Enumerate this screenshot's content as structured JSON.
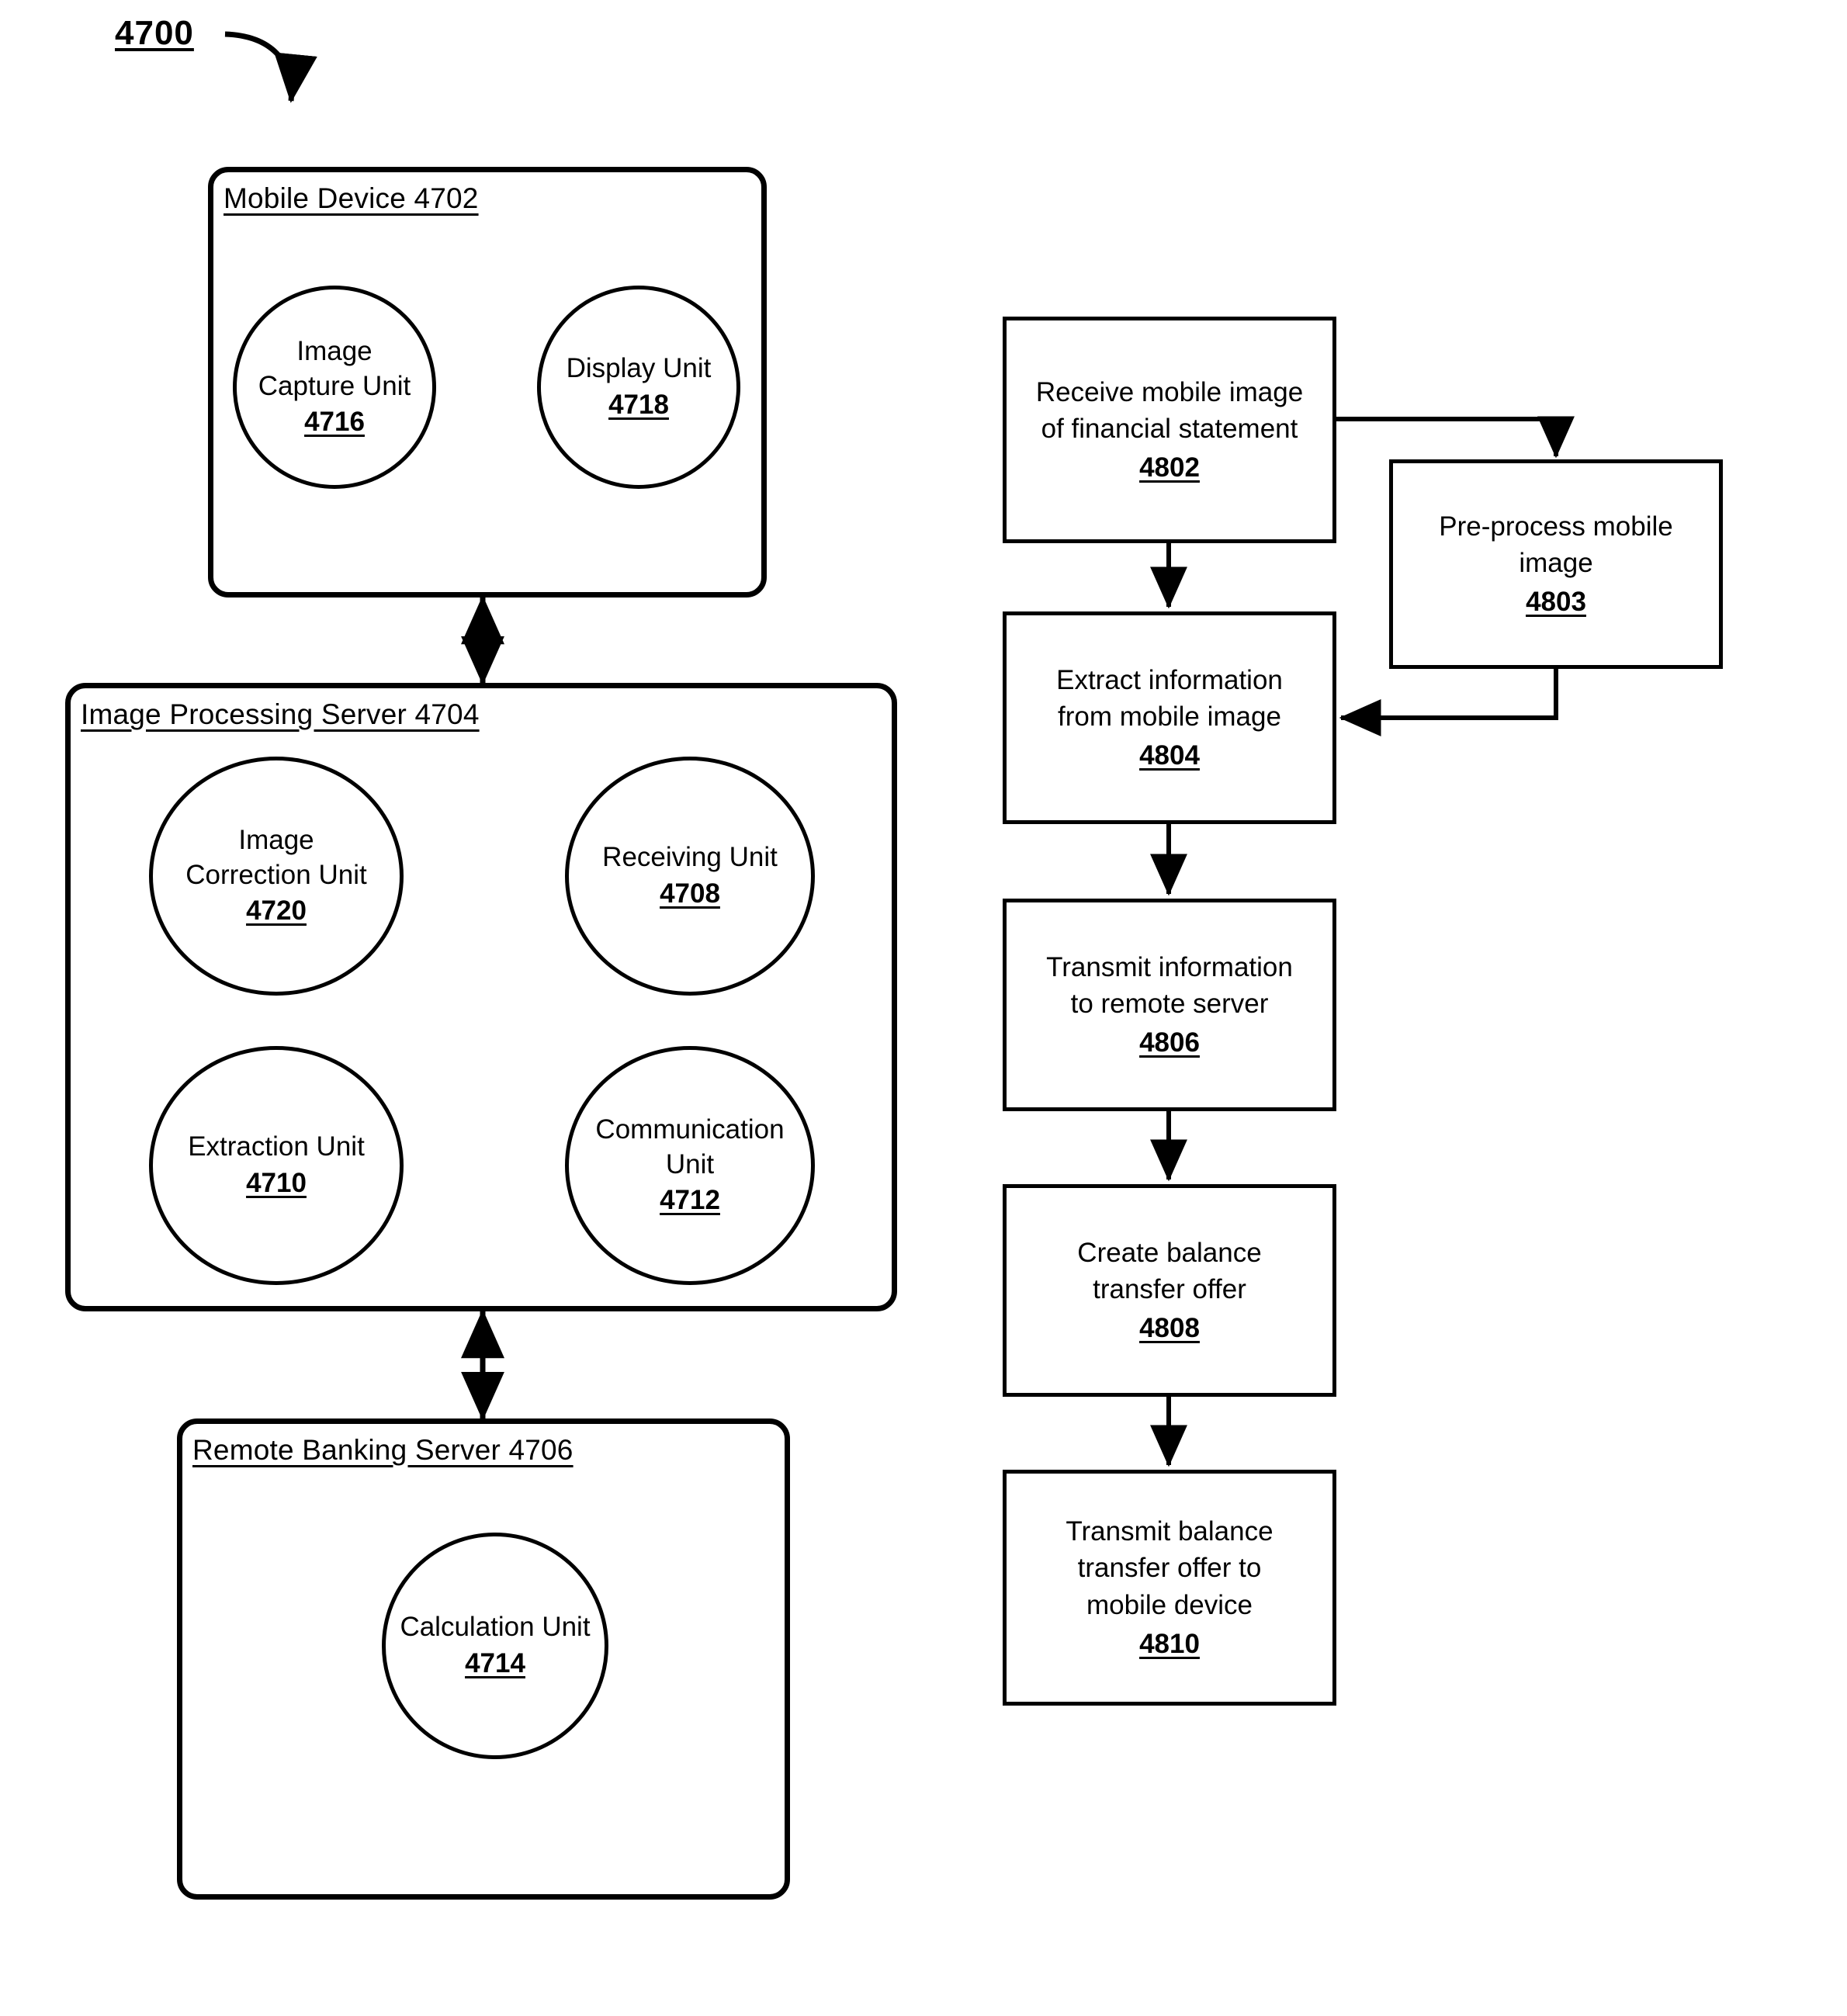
{
  "figure": {
    "number": "4700"
  },
  "system_diagram": {
    "mobile_device": {
      "title": "Mobile Device 4702",
      "units": [
        {
          "name": "Image Capture Unit",
          "line1": "Image",
          "line2": "Capture Unit",
          "ref": "4716"
        },
        {
          "name": "Display Unit",
          "line1": "Display Unit",
          "line2": "",
          "ref": "4718"
        }
      ]
    },
    "image_processing_server": {
      "title": "Image Processing Server 4704",
      "units": [
        {
          "name": "Image Correction Unit",
          "line1": "Image",
          "line2": "Correction Unit",
          "ref": "4720"
        },
        {
          "name": "Receiving Unit",
          "line1": "Receiving Unit",
          "line2": "",
          "ref": "4708"
        },
        {
          "name": "Extraction Unit",
          "line1": "Extraction Unit",
          "line2": "",
          "ref": "4710"
        },
        {
          "name": "Communication Unit",
          "line1": "Communication",
          "line2": "Unit",
          "ref": "4712"
        }
      ]
    },
    "remote_banking_server": {
      "title": "Remote Banking Server 4706",
      "units": [
        {
          "name": "Calculation Unit",
          "line1": "Calculation Unit",
          "line2": "",
          "ref": "4714"
        }
      ]
    }
  },
  "flowchart": {
    "steps": [
      {
        "id": "step-4802",
        "line1": "Receive mobile image",
        "line2": "of financial statement",
        "line3": "",
        "ref": "4802"
      },
      {
        "id": "step-4803",
        "line1": "Pre-process mobile",
        "line2": "image",
        "line3": "",
        "ref": "4803"
      },
      {
        "id": "step-4804",
        "line1": "Extract information",
        "line2": "from mobile image",
        "line3": "",
        "ref": "4804"
      },
      {
        "id": "step-4806",
        "line1": "Transmit information",
        "line2": "to remote server",
        "line3": "",
        "ref": "4806"
      },
      {
        "id": "step-4808",
        "line1": "Create balance",
        "line2": "transfer offer",
        "line3": "",
        "ref": "4808"
      },
      {
        "id": "step-4810",
        "line1": "Transmit balance",
        "line2": "transfer offer to",
        "line3": "mobile device",
        "ref": "4810"
      }
    ]
  },
  "colors": {
    "line": "#000000",
    "background": "#ffffff"
  }
}
